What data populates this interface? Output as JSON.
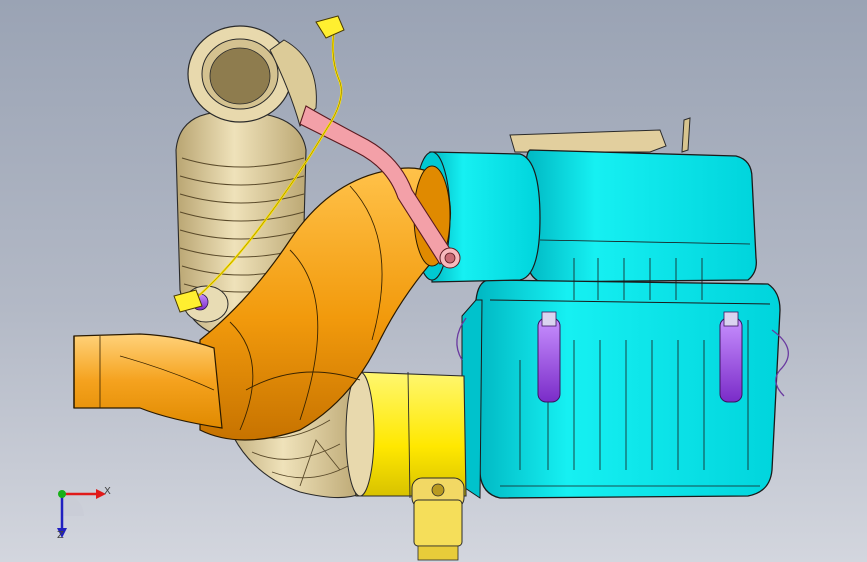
{
  "triad": {
    "x_label": "X",
    "z_label": "Z"
  },
  "colors": {
    "background_top": "#9aa3b4",
    "background_bottom": "#d3d6de",
    "air_box": "#00e0e6",
    "air_box_dark": "#00b7c2",
    "duct_orange": "#f29a0c",
    "duct_orange_light": "#ffc24a",
    "bellows_tan": "#d9c79a",
    "yellow_coupler": "#ffef00",
    "pink_tube": "#f3a0a8",
    "violet_clip": "#a050e0",
    "axis_x": "#e01a1a",
    "axis_y": "#18b018",
    "axis_z": "#2020c0"
  },
  "icons": [
    "coordinate-triad-icon"
  ]
}
